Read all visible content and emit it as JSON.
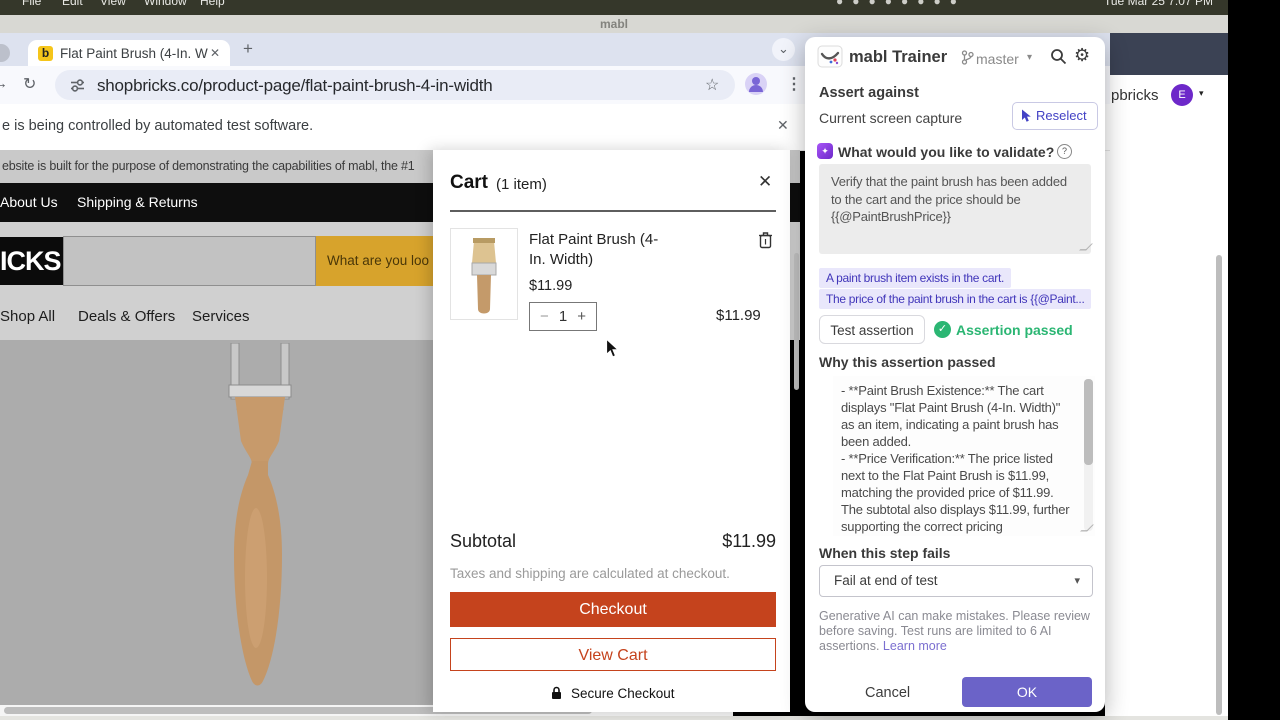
{
  "menubar": {
    "items": [
      "File",
      "Edit",
      "View",
      "Window",
      "Help"
    ],
    "clock": "Tue Mar 25  7:07 PM"
  },
  "mabl_window": {
    "title": "mabl"
  },
  "browser": {
    "tab": {
      "favicon_letter": "b",
      "title": "Flat Paint Brush (4-In. Width)"
    },
    "url": "shopbricks.co/product-page/flat-paint-brush-4-in-width",
    "infobar_text": "e is being controlled by automated test software."
  },
  "site": {
    "notice": "ebsite is built for the purpose of demonstrating the capabilities of mabl, the #1",
    "top_nav": [
      "About Us",
      "Shipping & Returns"
    ],
    "logo_text": "ICKS",
    "search_placeholder": "What are you loo",
    "main_nav": [
      "Shop All",
      "Deals & Offers",
      "Services"
    ],
    "account": {
      "name": "pbricks",
      "avatar": "E"
    }
  },
  "cart": {
    "title": "Cart",
    "count": "(1 item)",
    "item": {
      "name": "Flat Paint Brush (4-In. Width)",
      "price": "$11.99",
      "qty": "1",
      "line_total": "$11.99"
    },
    "subtotal_label": "Subtotal",
    "subtotal_value": "$11.99",
    "taxes_note": "Taxes and shipping are calculated at checkout.",
    "checkout_label": "Checkout",
    "view_cart_label": "View Cart",
    "secure_label": "Secure Checkout"
  },
  "trainer": {
    "title": "mabl Trainer",
    "branch": "master",
    "assert_against_label": "Assert against",
    "capture_label": "Current screen capture",
    "reselect_label": "Reselect",
    "prompt_label": "What would you like to validate?",
    "prompt_value": "Verify that the paint brush has been added to the cart and the price should be {{@PaintBrushPrice}}",
    "suggestions": [
      "A paint brush item exists in the cart.",
      "The price of the paint brush in the cart is {{@Paint..."
    ],
    "test_button_label": "Test assertion",
    "passed_label": "Assertion passed",
    "why_title": "Why this assertion passed",
    "why_text": "- **Paint Brush Existence:** The cart displays \"Flat Paint Brush (4-In. Width)\" as an item, indicating a paint brush has been added.\n- **Price Verification:** The price listed next to the Flat Paint Brush is $11.99, matching the provided price of $11.99. The subtotal also displays $11.99, further supporting the correct pricing",
    "fail_label": "When this step fails",
    "fail_option": "Fail at end of test",
    "disclaimer": "Generative AI can make mistakes. Please review before saving. Test runs are limited to 6 AI assertions. ",
    "learn_more_label": "Learn more",
    "cancel_label": "Cancel",
    "ok_label": "OK"
  },
  "icons": {
    "close": "✕",
    "plus": "+",
    "minus": "−",
    "caret_down": "▾",
    "chevron_down": "⌄",
    "reload": "↻",
    "star": "☆",
    "kebab": "⋮",
    "gear": "⚙",
    "check": "✓",
    "question": "?",
    "sparkle": "✦",
    "forward": "→"
  },
  "colors": {
    "accent_orange": "#c5431d",
    "mabl_purple": "#6b63c8",
    "chip_purple": "#4136ba",
    "success_green": "#2bb673",
    "search_gold": "#d7a32c",
    "favicon_yellow": "#f5c51a",
    "avatar_purple": "#6d28c9"
  }
}
